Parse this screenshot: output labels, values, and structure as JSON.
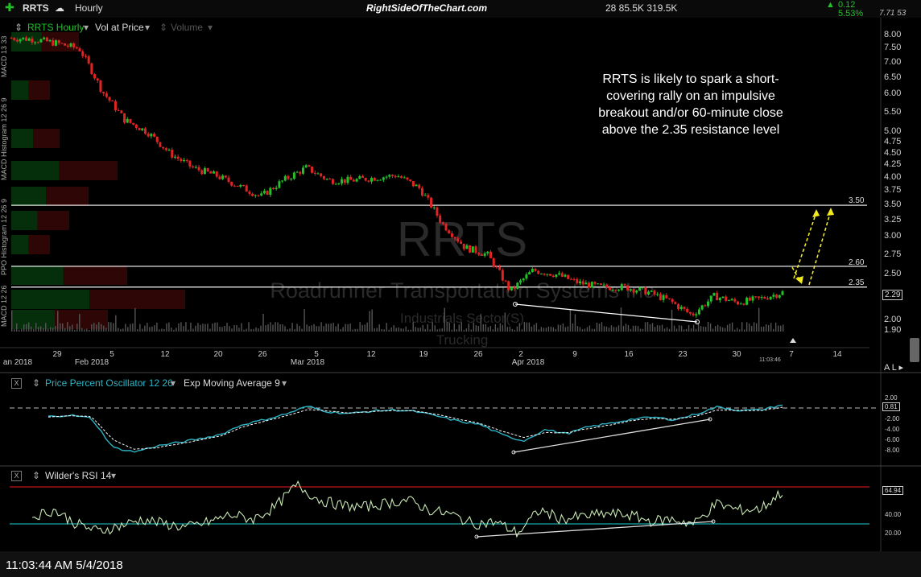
{
  "toolbar": {
    "ticker": "RRTS",
    "interval": "Hourly",
    "site": "RightSideOfTheChart.com",
    "stats": "28  85.5K  319.5K",
    "change": "0.12",
    "change_pct": "5.53%",
    "quote": "7.71  53"
  },
  "price_panel": {
    "series_label": "RRTS Hourly",
    "overlay_label": "Vol at Price",
    "volume_label": "Volume",
    "watermark_ticker": "RRTS",
    "watermark_company": "Roadrunner Transportation Systems Inc",
    "watermark_sector": "Industrials Sector(S)",
    "watermark_industry": "Trucking",
    "annotation": "RRTS is likely to spark a short-covering rally on an impulsive breakout and/or 60-minute close above the 2.35 resistance level",
    "annotation_lines": [
      "RRTS is likely to spark a short-",
      "covering rally on an impulsive",
      "breakout and/or 60-minute close",
      "above the 2.35 resistance level"
    ],
    "last_price": "2.29",
    "time_label": "11:03:46",
    "left_tabs": [
      "MACD 13 33",
      "MACD Histogram 12 26 9",
      "PPO Histogram 12 26 9",
      "MACD 12 26"
    ]
  },
  "chart_data": [
    {
      "type": "line",
      "title": "RRTS Hourly",
      "yscale": "log",
      "ylim": [
        1.9,
        8.0
      ],
      "y_ticks": [
        "8.00",
        "7.50",
        "7.00",
        "6.50",
        "6.00",
        "5.50",
        "5.00",
        "4.75",
        "4.50",
        "4.25",
        "4.00",
        "3.75",
        "3.50",
        "3.25",
        "3.00",
        "2.75",
        "2.50",
        "2.25",
        "2.00",
        "1.90"
      ],
      "x_ticks": [
        "an 2018",
        "29",
        "Feb 2018",
        "5",
        "12",
        "20",
        "26",
        "Mar 2018",
        "5",
        "12",
        "19",
        "26",
        "2",
        "Apr 2018",
        "9",
        "16",
        "23",
        "30",
        "7",
        "14"
      ],
      "x": [
        "Jan 24",
        "Jan 26",
        "Jan 29",
        "Feb 1",
        "Feb 2",
        "Feb 5",
        "Feb 6",
        "Feb 8",
        "Feb 12",
        "Feb 16",
        "Feb 20",
        "Feb 22",
        "Feb 26",
        "Feb 28",
        "Mar 5",
        "Mar 12",
        "Mar 16",
        "Mar 19",
        "Mar 22",
        "Mar 26",
        "Mar 28",
        "Mar 29",
        "Apr 2",
        "Apr 3",
        "Apr 5",
        "Apr 9",
        "Apr 13",
        "Apr 16",
        "Apr 20",
        "Apr 23",
        "Apr 25",
        "Apr 26",
        "Apr 30",
        "May 2",
        "May 4"
      ],
      "series": [
        {
          "name": "RRTS Hourly",
          "values": [
            7.9,
            7.85,
            7.7,
            7.5,
            6.1,
            5.3,
            5.0,
            4.5,
            4.2,
            4.05,
            3.85,
            3.65,
            3.95,
            4.2,
            3.95,
            3.95,
            4.0,
            4.05,
            3.8,
            3.2,
            2.85,
            2.75,
            2.3,
            2.55,
            2.5,
            2.4,
            2.35,
            2.35,
            2.3,
            2.2,
            2.05,
            2.25,
            2.18,
            2.22,
            2.29
          ]
        }
      ],
      "horizontal_lines": [
        {
          "label": "3.50",
          "value": 3.5
        },
        {
          "label": "2.60",
          "value": 2.6
        },
        {
          "label": "2.35",
          "value": 2.35
        }
      ]
    },
    {
      "type": "line",
      "title": "Price Percent Oscillator 12 26",
      "ylim": [
        -9.0,
        2.5
      ],
      "y_ticks": [
        "2.00",
        "-2.00",
        "-4.00",
        "-6.00",
        "-8.00"
      ],
      "last_value": "0.81",
      "series": [
        {
          "name": "Price Percent Oscillator 12 26",
          "values": [
            -1.5,
            -1.2,
            -1.8,
            -7.5,
            -8.3,
            -7.2,
            -6.5,
            -5.8,
            -4.9,
            -3.0,
            -2.1,
            -1.0,
            0.5,
            -0.6,
            -0.9,
            -0.4,
            -0.2,
            -0.5,
            -1.4,
            -2.4,
            -3.0,
            -5.0,
            -6.2,
            -4.0,
            -4.8,
            -3.5,
            -2.8,
            -2.0,
            -1.6,
            -2.1,
            -1.0,
            0.4,
            -0.3,
            -0.2,
            0.8
          ]
        },
        {
          "name": "Exp Moving Average 9",
          "values": [
            -1.6,
            -1.3,
            -1.5,
            -6.0,
            -7.8,
            -7.5,
            -6.8,
            -6.0,
            -5.2,
            -3.5,
            -2.4,
            -1.4,
            -0.1,
            -0.4,
            -0.8,
            -0.5,
            -0.3,
            -0.4,
            -1.1,
            -2.0,
            -2.8,
            -4.3,
            -5.5,
            -4.6,
            -4.6,
            -3.8,
            -3.1,
            -2.3,
            -1.8,
            -2.0,
            -1.4,
            -0.2,
            -0.3,
            -0.3,
            0.3
          ]
        }
      ]
    },
    {
      "type": "line",
      "title": "Wilder's RSI 14",
      "ylim": [
        5,
        80
      ],
      "y_ticks": [
        "40.00",
        "20.00"
      ],
      "overbought": 70,
      "oversold": 30,
      "last_value": "64.94",
      "series": [
        {
          "name": "Wilder's RSI 14",
          "values": [
            38,
            45,
            30,
            22,
            28,
            35,
            30,
            26,
            32,
            40,
            35,
            48,
            72,
            56,
            50,
            48,
            52,
            56,
            45,
            40,
            30,
            32,
            20,
            45,
            35,
            38,
            41,
            40,
            33,
            35,
            30,
            52,
            45,
            46,
            65
          ]
        }
      ]
    }
  ],
  "ppo_header": {
    "label": "Price Percent Oscillator 12 26",
    "ma_label": "Exp Moving Average 9"
  },
  "rsi_header": {
    "label": "Wilder's RSI 14"
  },
  "footer": {
    "timestamp": "11:03:44 AM 5/4/2018"
  },
  "colors": {
    "up": "#22c12a",
    "down": "#e02424",
    "ppo": "#2bb3c4",
    "rsi": "#c8e8b4",
    "support": "#ffffff",
    "arrow": "#f2ea1d",
    "rsi_upper": "#c0141a",
    "rsi_lower": "#1aa6a6"
  }
}
